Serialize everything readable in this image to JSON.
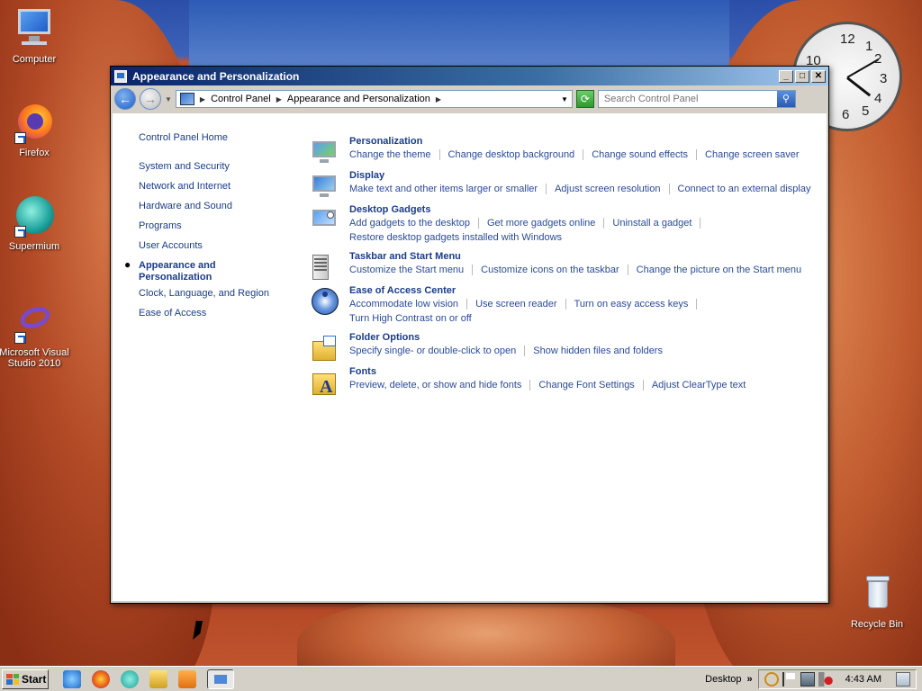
{
  "desktop": {
    "icons": [
      {
        "label": "Computer",
        "icon": "computer-icon"
      },
      {
        "label": "Firefox",
        "icon": "firefox-icon"
      },
      {
        "label": "Supermium",
        "icon": "supermium-icon"
      },
      {
        "label": "Microsoft Visual Studio 2010",
        "icon": "visual-studio-icon"
      },
      {
        "label": "Recycle Bin",
        "icon": "recycle-bin-icon"
      }
    ],
    "clock_numbers": [
      "12",
      "1",
      "2",
      "3",
      "4",
      "5",
      "6",
      "10"
    ]
  },
  "window": {
    "title": "Appearance and Personalization",
    "breadcrumb": [
      "Control Panel",
      "Appearance and Personalization"
    ],
    "search_placeholder": "Search Control Panel"
  },
  "sidebar": {
    "items": [
      "Control Panel Home",
      "System and Security",
      "Network and Internet",
      "Hardware and Sound",
      "Programs",
      "User Accounts",
      "Appearance and Personalization",
      "Clock, Language, and Region",
      "Ease of Access"
    ]
  },
  "categories": [
    {
      "title": "Personalization",
      "links": [
        "Change the theme",
        "Change desktop background",
        "Change sound effects",
        "Change screen saver"
      ],
      "links2": ""
    },
    {
      "title": "Display",
      "links": [
        "Make text and other items larger or smaller",
        "Adjust screen resolution",
        "Connect to an external display"
      ],
      "links2": ""
    },
    {
      "title": "Desktop Gadgets",
      "links": [
        "Add gadgets to the desktop",
        "Get more gadgets online",
        "Uninstall a gadget"
      ],
      "links2": "Restore desktop gadgets installed with Windows"
    },
    {
      "title": "Taskbar and Start Menu",
      "links": [
        "Customize the Start menu",
        "Customize icons on the taskbar",
        "Change the picture on the Start menu"
      ],
      "links2": ""
    },
    {
      "title": "Ease of Access Center",
      "links": [
        "Accommodate low vision",
        "Use screen reader",
        "Turn on easy access keys"
      ],
      "links2": "Turn High Contrast on or off"
    },
    {
      "title": "Folder Options",
      "links": [
        "Specify single- or double-click to open",
        "Show hidden files and folders"
      ],
      "links2": ""
    },
    {
      "title": "Fonts",
      "links": [
        "Preview, delete, or show and hide fonts",
        "Change Font Settings",
        "Adjust ClearType text"
      ],
      "links2": ""
    }
  ],
  "taskbar": {
    "start_label": "Start",
    "toolbar_label": "Desktop",
    "chevron": "»",
    "time": "4:43 AM"
  }
}
